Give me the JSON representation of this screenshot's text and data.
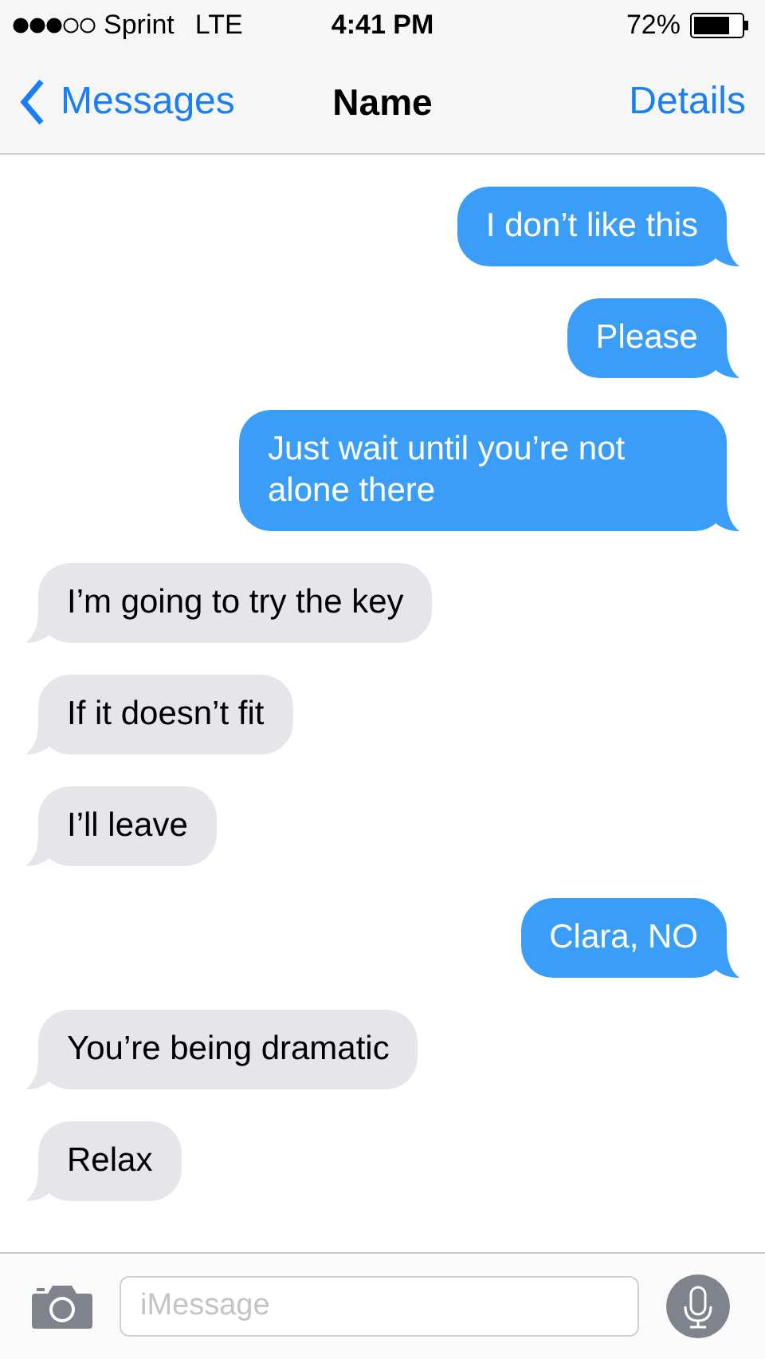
{
  "status_bar": {
    "carrier": "Sprint",
    "network": "LTE",
    "time": "4:41 PM",
    "battery": "72%"
  },
  "nav_bar": {
    "back": "Messages",
    "title": "Name",
    "action": "Details"
  },
  "messages": [
    {
      "kind": "sent",
      "text": "I don’t like this"
    },
    {
      "kind": "sent",
      "text": "Please"
    },
    {
      "kind": "sent",
      "text": "Just wait until you’re not alone there"
    },
    {
      "kind": "received",
      "text": "I’m going to try the key"
    },
    {
      "kind": "received",
      "text": "If it doesn’t fit"
    },
    {
      "kind": "received",
      "text": "I’ll leave"
    },
    {
      "kind": "sent",
      "text": "Clara, NO"
    },
    {
      "kind": "received",
      "text": "You’re being dramatic"
    },
    {
      "kind": "received",
      "text": "Relax"
    }
  ],
  "input_bar": {
    "placeholder": "iMessage"
  }
}
